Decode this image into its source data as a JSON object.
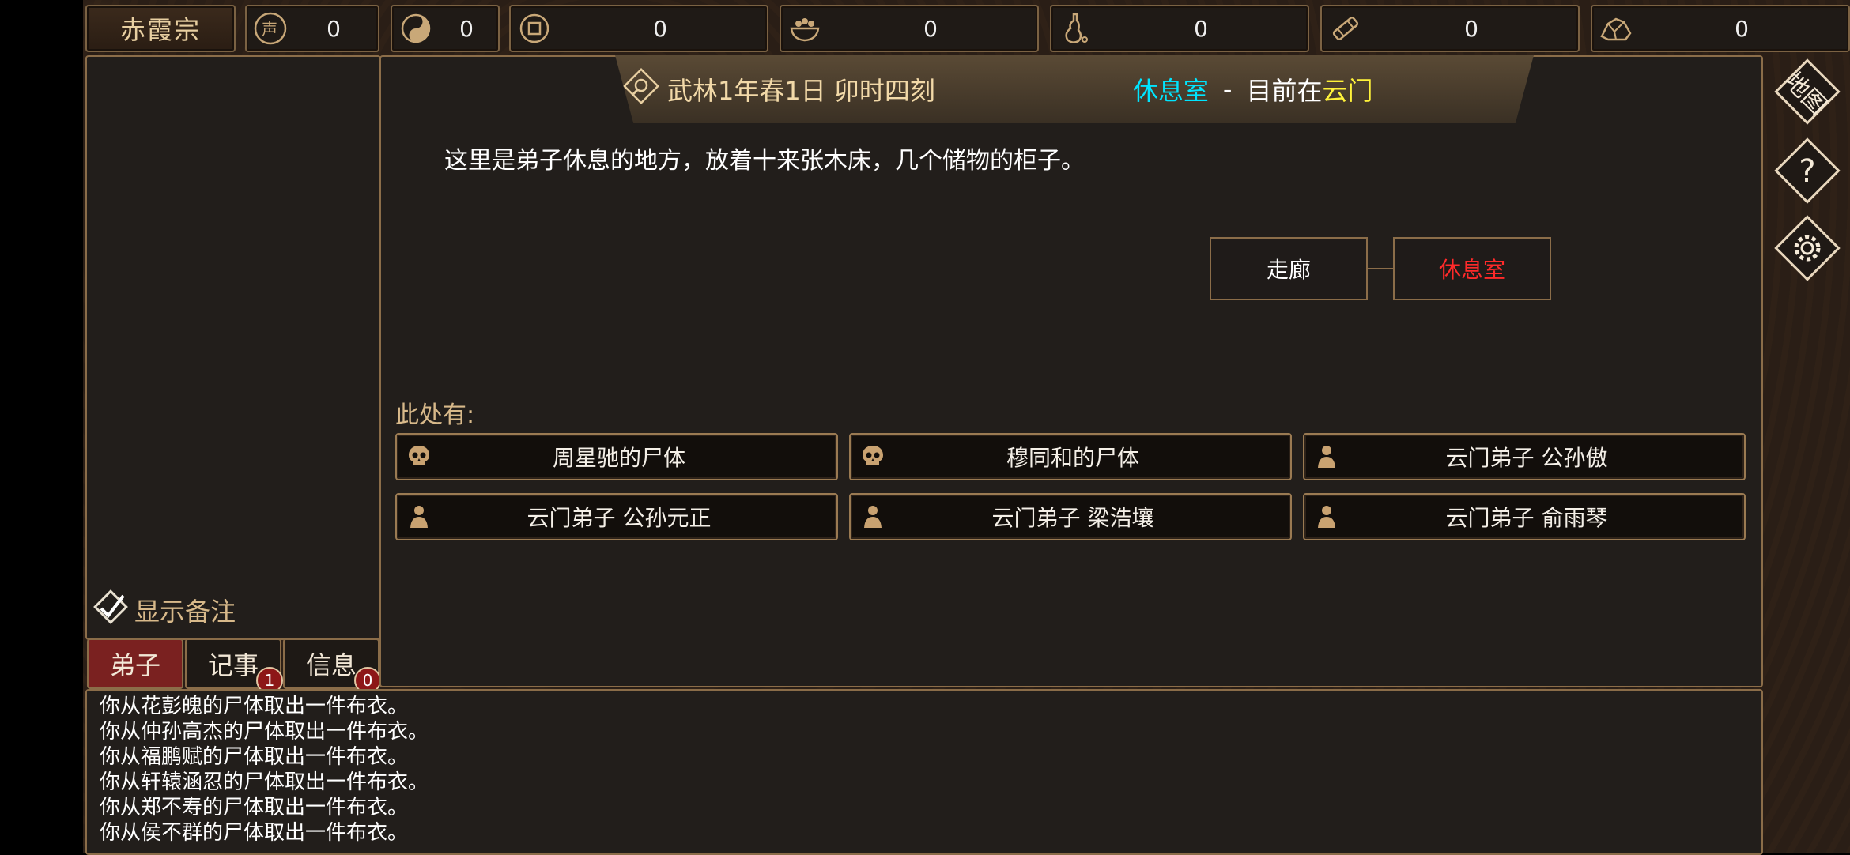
{
  "colors": {
    "accent": "#8b6d49",
    "room_highlight": "#00e5ff",
    "sect_highlight": "#fff23a",
    "current_room": "#ff2a2a"
  },
  "topbar": {
    "sect_name": "赤霞宗",
    "stats": [
      {
        "icon": "reputation-icon",
        "value": "0"
      },
      {
        "icon": "yin-yang-icon",
        "value": "0"
      },
      {
        "icon": "coin-icon",
        "value": "0"
      },
      {
        "icon": "food-bowl-icon",
        "value": "0"
      },
      {
        "icon": "gourd-icon",
        "value": "0"
      },
      {
        "icon": "scroll-icon",
        "value": "0"
      },
      {
        "icon": "ore-icon",
        "value": "0"
      }
    ]
  },
  "left": {
    "show_notes_label": "显示备注",
    "tabs": [
      {
        "label": "弟子",
        "badge": ""
      },
      {
        "label": "记事",
        "badge": "1"
      },
      {
        "label": "信息",
        "badge": "0"
      }
    ]
  },
  "header": {
    "date": "武林1年春1日 卯时四刻",
    "room": "休息室",
    "separator": "-",
    "location_prefix": "目前在",
    "location": "云门"
  },
  "room": {
    "description": "这里是弟子休息的地方，放着十来张木床，几个储物的柜子。",
    "map": {
      "neighbor": "走廊",
      "current": "休息室"
    }
  },
  "here": {
    "label": "此处有:",
    "entities": [
      {
        "type": "corpse",
        "name": "周星驰的尸体"
      },
      {
        "type": "corpse",
        "name": "穆同和的尸体"
      },
      {
        "type": "person",
        "name": "云门弟子 公孙傲"
      },
      {
        "type": "person",
        "name": "云门弟子 公孙元正"
      },
      {
        "type": "person",
        "name": "云门弟子 梁浩壤"
      },
      {
        "type": "person",
        "name": "云门弟子 俞雨琴"
      }
    ]
  },
  "log": [
    "你从花彭魄的尸体取出一件布衣。",
    "你从仲孙高杰的尸体取出一件布衣。",
    "你从福鹏赋的尸体取出一件布衣。",
    "你从轩辕涵忍的尸体取出一件布衣。",
    "你从郑不寿的尸体取出一件布衣。",
    "你从侯不群的尸体取出一件布衣。"
  ],
  "side": {
    "map_label": "地图"
  }
}
